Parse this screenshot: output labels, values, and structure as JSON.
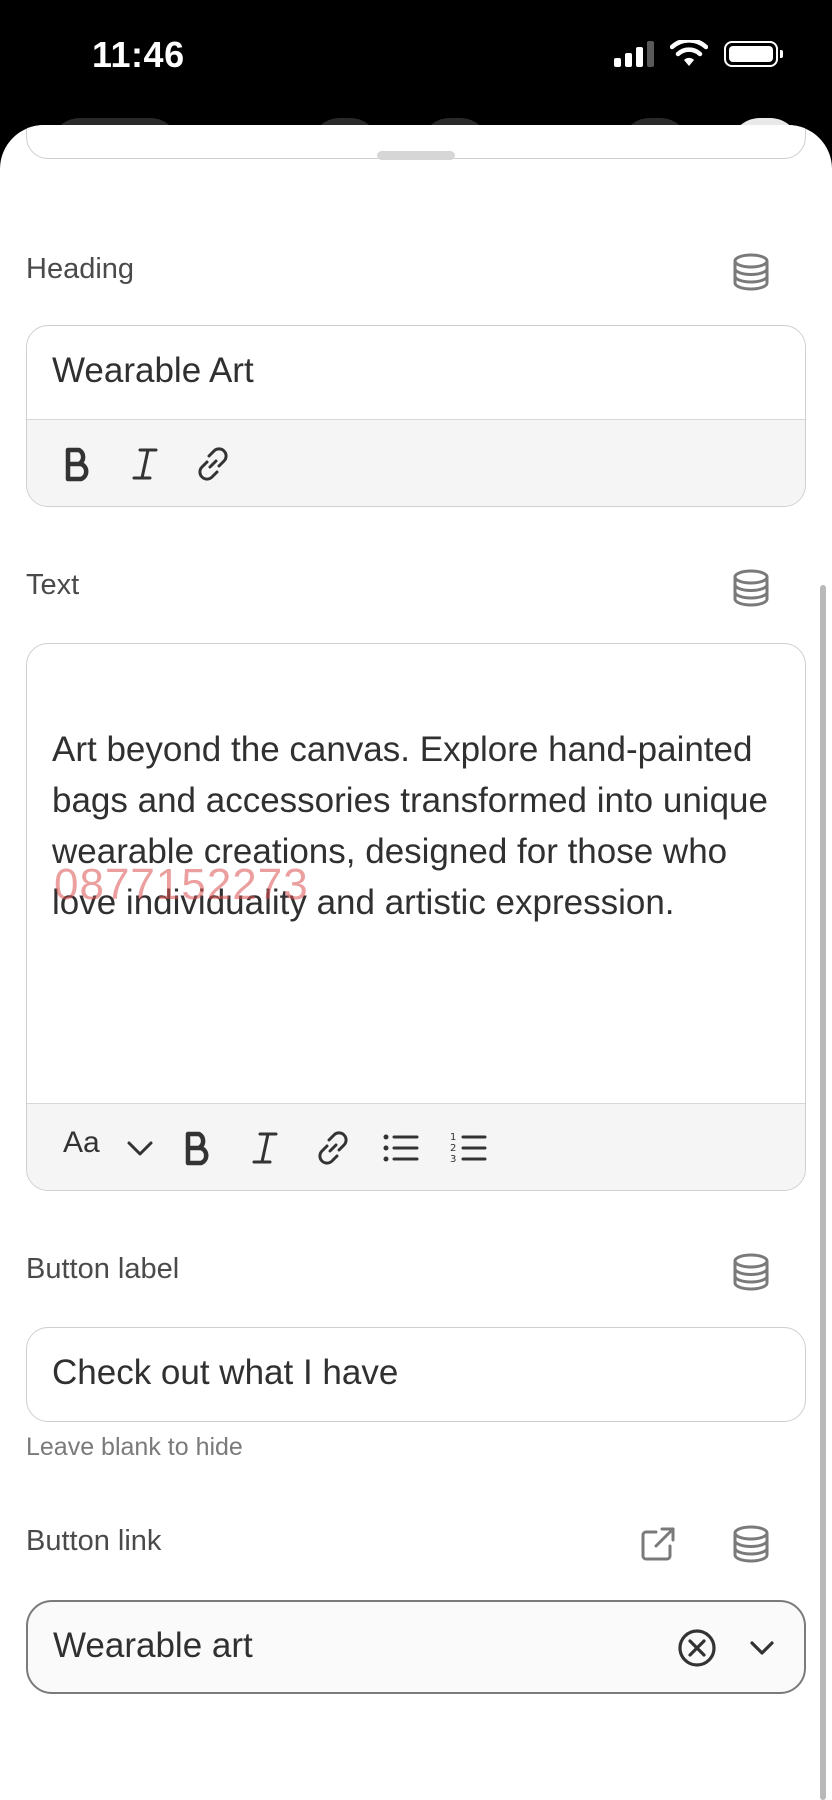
{
  "status_bar": {
    "time": "11:46"
  },
  "heading_field": {
    "label": "Heading",
    "value": "Wearable Art"
  },
  "text_field": {
    "label": "Text",
    "value": "Art beyond the canvas. Explore hand-painted bags and accessories transformed into unique wearable creations, designed for those who love individuality and artistic expression.",
    "format_label": "Aa"
  },
  "button_label_field": {
    "label": "Button label",
    "value": "Check out what I have",
    "hint": "Leave blank to hide"
  },
  "button_link_field": {
    "label": "Button link",
    "value": "Wearable art"
  },
  "overlay": {
    "watermark": "0877152273"
  },
  "icons": {
    "data_source": "database-icon",
    "bold": "bold-icon",
    "italic": "italic-icon",
    "link": "link-icon",
    "bullet_list": "bullet-list-icon",
    "numbered_list": "numbered-list-icon",
    "external": "external-link-icon",
    "clear": "clear-circle-icon",
    "chevron": "chevron-down-icon"
  }
}
